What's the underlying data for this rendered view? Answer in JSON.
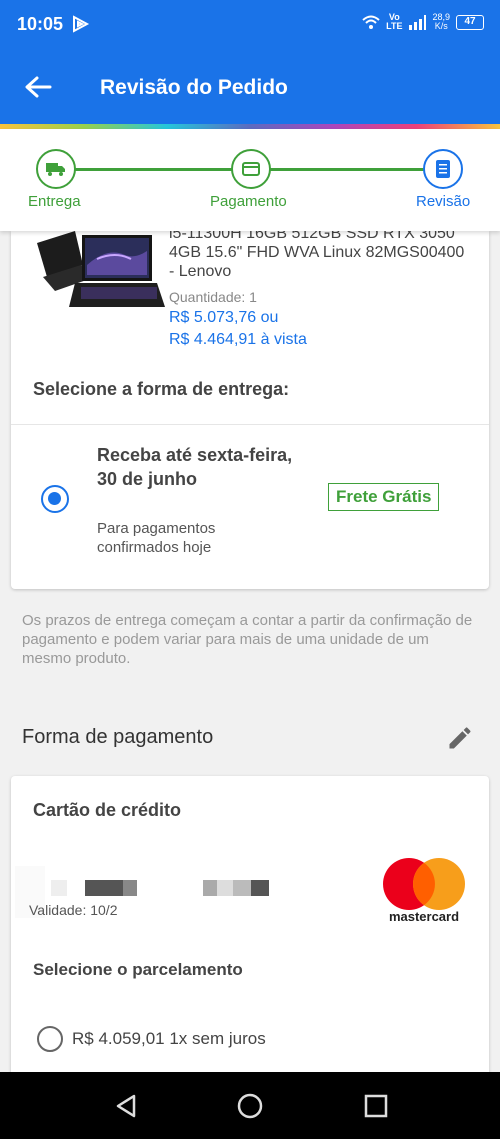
{
  "status_bar": {
    "time": "10:05",
    "network_top": "Vo",
    "network_bottom": "LTE",
    "speed_value": "28,9",
    "speed_unit": "K/s",
    "battery": "47",
    "icons": [
      "play-icon",
      "wifi-icon",
      "signal-icon",
      "battery-icon"
    ]
  },
  "app_bar": {
    "title": "Revisão do Pedido",
    "back_icon": "arrow-left-icon"
  },
  "stepper": {
    "steps": [
      {
        "label": "Entrega",
        "icon": "truck-icon",
        "state": "done"
      },
      {
        "label": "Pagamento",
        "icon": "card-icon",
        "state": "done"
      },
      {
        "label": "Revisão",
        "icon": "document-icon",
        "state": "current"
      }
    ]
  },
  "product": {
    "name": "i5-11300H 16GB 512GB SSD RTX 3050 4GB 15.6\" FHD WVA Linux 82MGS00400 - Lenovo",
    "quantity": "Quantidade: 1",
    "price_installment": "R$ 5.073,76 ou",
    "price_cash": "R$ 4.464,91 à vista"
  },
  "delivery": {
    "section_title": "Selecione a forma de entrega:",
    "option_title": "Receba até sexta-feira, 30 de junho",
    "option_subtitle": "Para pagamentos confirmados hoje",
    "badge": "Frete Grátis",
    "notice": "Os prazos de entrega começam a contar a partir da confirmação de pagamento e podem variar para mais de uma unidade de um mesmo produto."
  },
  "payment": {
    "section_title": "Forma de pagamento",
    "edit_icon": "pencil-icon",
    "card_title": "Cartão de crédito",
    "card_validity": "Validade: 10/2",
    "brand": "mastercard",
    "installments_title": "Selecione o parcelamento",
    "installment_option": "R$ 4.059,01 1x sem juros"
  },
  "colors": {
    "primary": "#1a73e8",
    "success": "#3fa03a",
    "mastercard_red": "#eb001b",
    "mastercard_orange": "#f79e1b"
  },
  "nav_bar": {
    "buttons": [
      "back-triangle-icon",
      "home-circle-icon",
      "recents-square-icon"
    ]
  }
}
